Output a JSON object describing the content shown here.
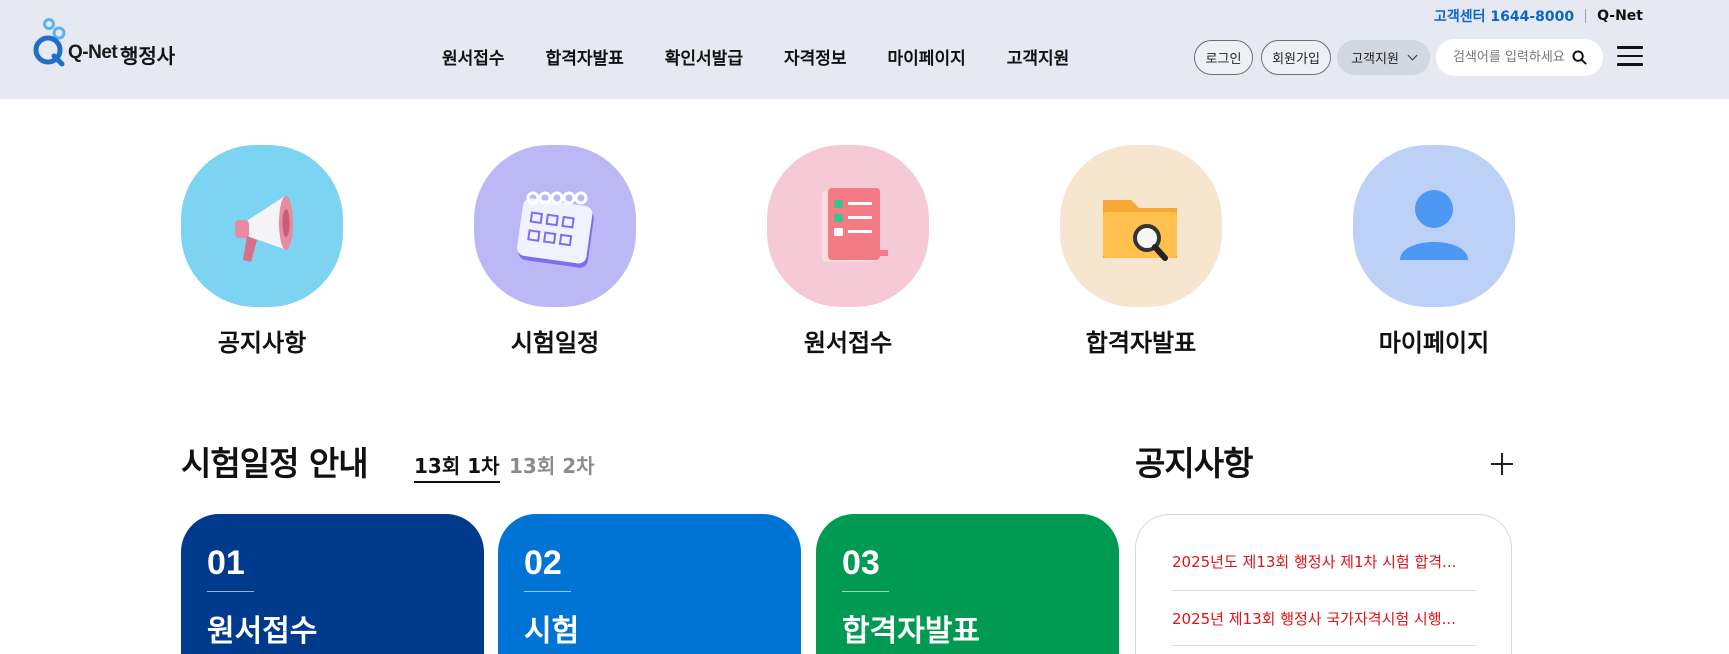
{
  "header": {
    "cs_center": "고객센터 1644-8000",
    "qnet_link": "Q-Net",
    "logo_text": "Q-Net",
    "service_name": "행정사",
    "nav": [
      "원서접수",
      "합격자발표",
      "확인서발급",
      "자격정보",
      "마이페이지",
      "고객지원"
    ],
    "login": "로그인",
    "join": "회원가입",
    "support": "고객지원",
    "search_placeholder": "검색어를 입력하세요"
  },
  "quick_menu": [
    {
      "label": "공지사항",
      "icon": "megaphone-icon",
      "bg": "#7dd3f2"
    },
    {
      "label": "시험일정",
      "icon": "calendar-icon",
      "bg": "#bcb8f6"
    },
    {
      "label": "원서접수",
      "icon": "checklist-icon",
      "bg": "#f5c9d6"
    },
    {
      "label": "합격자발표",
      "icon": "folder-search-icon",
      "bg": "#f6e6d0"
    },
    {
      "label": "마이페이지",
      "icon": "user-icon",
      "bg": "#bcd1f5"
    }
  ],
  "schedule": {
    "title": "시험일정 안내",
    "tabs": [
      "13회 1차",
      "13회 2차"
    ],
    "active_tab": "13회 1차",
    "steps": [
      {
        "num": "01",
        "label": "원서접수",
        "color": "#003a8c"
      },
      {
        "num": "02",
        "label": "시험",
        "color": "#0074d4"
      },
      {
        "num": "03",
        "label": "합격자발표",
        "color": "#009a52"
      }
    ]
  },
  "notice": {
    "title": "공지사항",
    "items": [
      "2025년도 제13회 행정사 제1차 시험 합격...",
      "2025년 제13회 행정사 국가자격시험 시행..."
    ],
    "item_color": "#e0121a"
  }
}
